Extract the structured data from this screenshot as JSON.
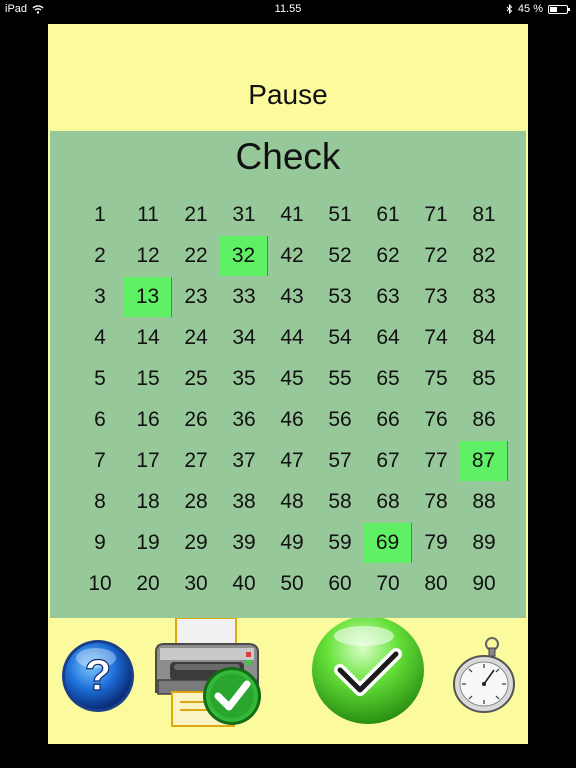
{
  "status_bar": {
    "device": "iPad",
    "time": "11.55",
    "battery": "45 %",
    "battery_level": 0.45
  },
  "header": {
    "pause_label": "Pause"
  },
  "check_panel": {
    "title": "Check",
    "numbers_start": 1,
    "numbers_end": 90,
    "rows": 10,
    "highlighted": [
      32,
      13,
      87,
      69
    ],
    "highlight_color": "#60f066",
    "panel_color": "#97c899"
  },
  "toolbar": {
    "icons": [
      "help-icon",
      "print-icon",
      "confirm-icon",
      "stopwatch-icon"
    ]
  },
  "colors": {
    "background": "#fbfa9d",
    "frame": "#000000"
  }
}
